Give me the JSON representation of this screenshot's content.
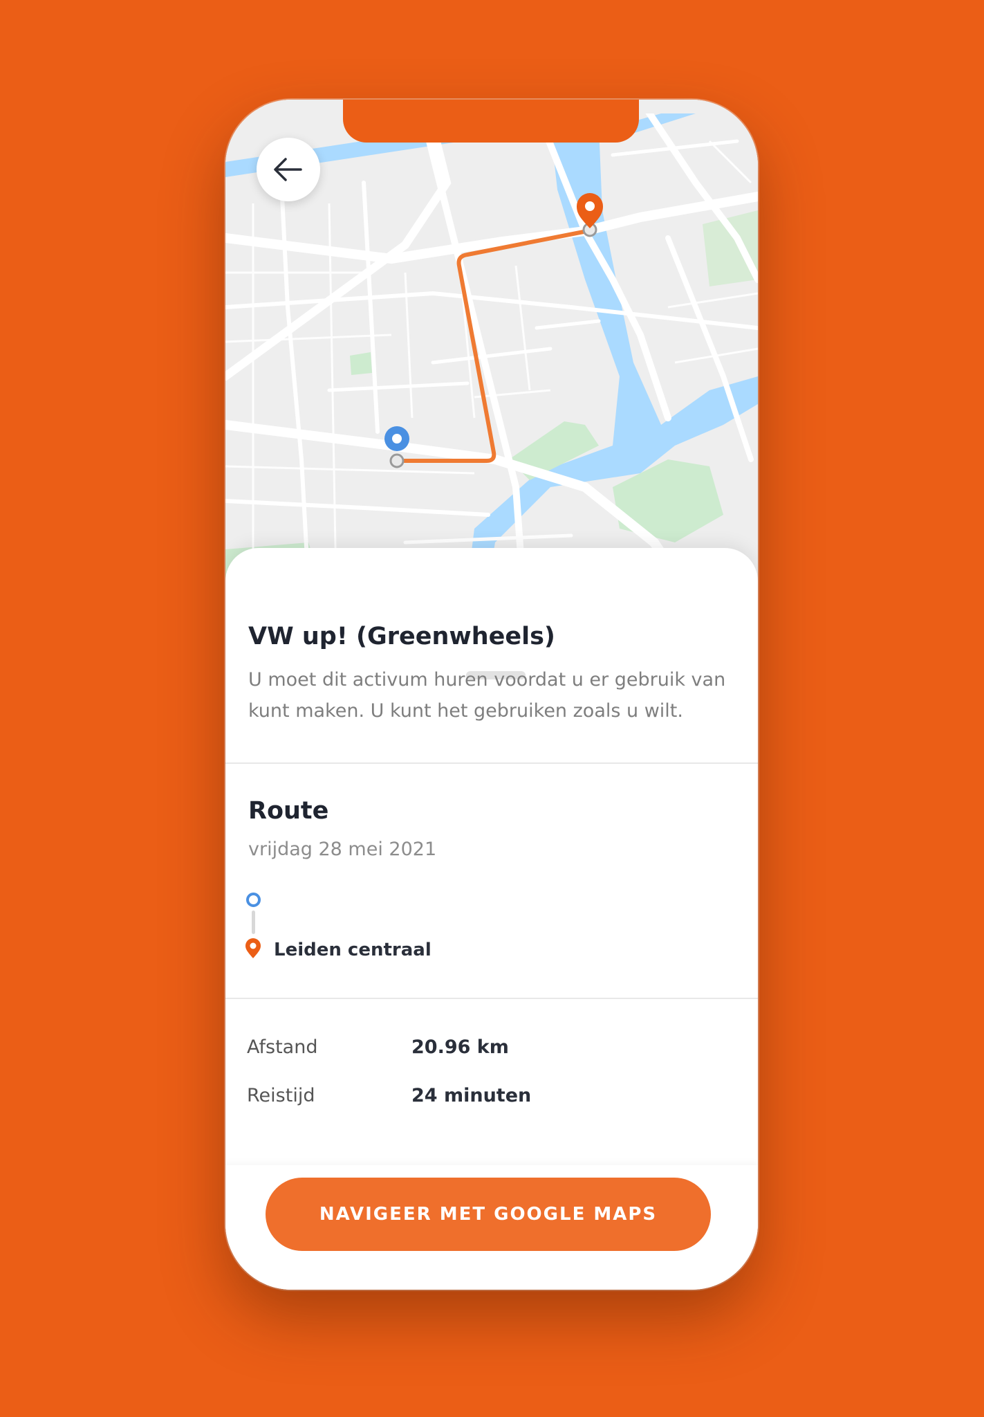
{
  "asset": {
    "title": "VW up! (Greenwheels)",
    "description": "U moet dit activum huren voordat u er gebruik van kunt maken. U kunt het gebruiken zoals u wilt."
  },
  "route": {
    "title": "Route",
    "date": "vrijdag 28 mei 2021",
    "destination": "Leiden centraal"
  },
  "stats": [
    {
      "label": "Afstand",
      "value": "20.96 km"
    },
    {
      "label": "Reistijd",
      "value": "24 minuten"
    }
  ],
  "actions": {
    "navigate_label": "NAVIGEER MET GOOGLE MAPS"
  },
  "icons": {
    "back": "arrow-left-icon",
    "start": "origin-dot-icon",
    "destination": "location-pin-icon"
  },
  "colors": {
    "background": "#EB5E16",
    "accent": "#EF6F2C",
    "origin": "#4A90E2",
    "water": "#AADAFF",
    "park": "#CDEBCF"
  }
}
